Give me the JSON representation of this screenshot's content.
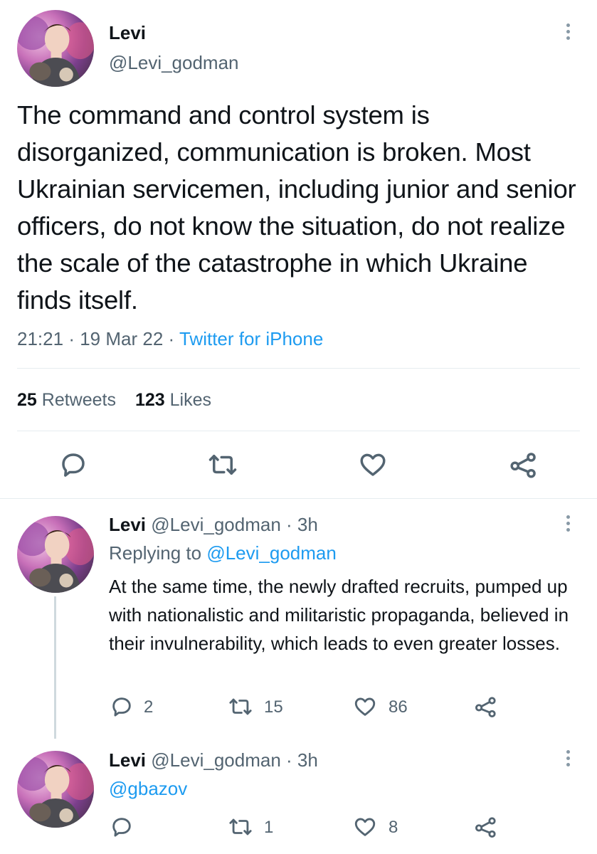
{
  "main_tweet": {
    "author_name": "Levi",
    "author_handle": "@Levi_godman",
    "text": "The command and control system is disorganized, communication is broken. Most Ukrainian servicemen, including junior and senior officers, do not know the situation, do not realize the scale of the catastrophe in which Ukraine finds itself.",
    "time": "21:21",
    "date": "19 Mar 22",
    "source": "Twitter for iPhone",
    "retweets_count": "25",
    "retweets_label": "Retweets",
    "likes_count": "123",
    "likes_label": "Likes"
  },
  "replies": [
    {
      "author_name": "Levi",
      "author_handle": "@Levi_godman",
      "time_ago": "3h",
      "replying_label": "Replying to",
      "replying_handle": "@Levi_godman",
      "text": "At the same time, the newly drafted recruits, pumped up with nationalistic and militaristic propaganda, believed in their invulnerability, which leads to even greater losses.",
      "reply_count": "2",
      "retweet_count": "15",
      "like_count": "86"
    },
    {
      "author_name": "Levi",
      "author_handle": "@Levi_godman",
      "time_ago": "3h",
      "mention": "@gbazov",
      "reply_count": "",
      "retweet_count": "1",
      "like_count": "8"
    }
  ],
  "separator": "·",
  "colors": {
    "accent": "#1d9bf0",
    "muted": "#536471",
    "text": "#0f1419",
    "divider": "#e6ecf0"
  },
  "icons": [
    "reply-icon",
    "retweet-icon",
    "like-icon",
    "share-icon",
    "more-options-icon"
  ]
}
